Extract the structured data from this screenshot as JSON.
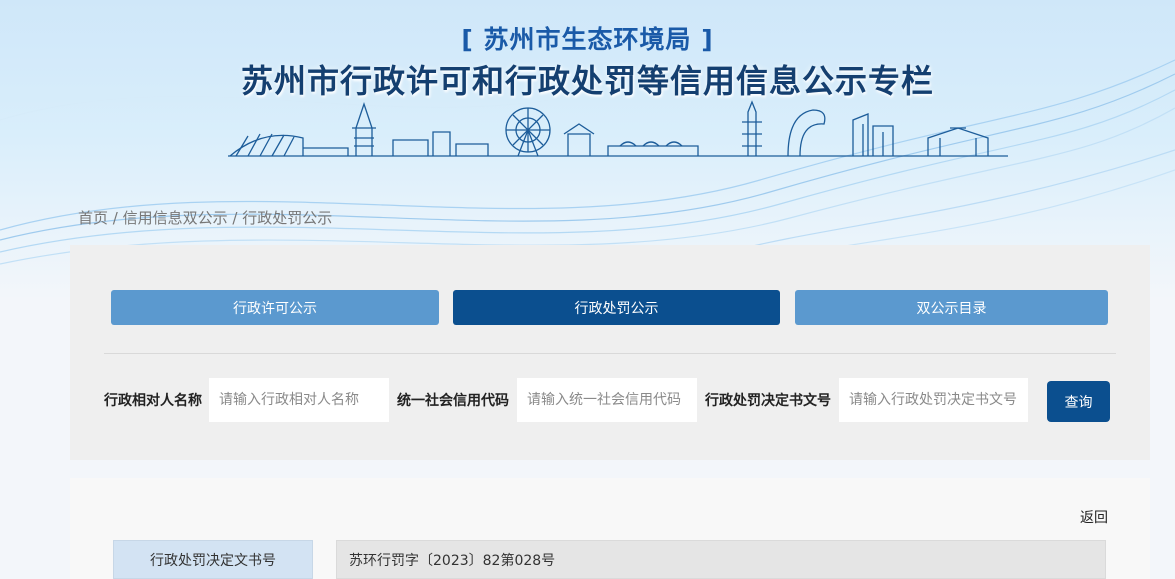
{
  "header": {
    "agency": "[ 苏州市生态环境局 ]",
    "title": "苏州市行政许可和行政处罚等信用信息公示专栏"
  },
  "breadcrumb": {
    "home": "首页",
    "sep": " / ",
    "level2": "信用信息双公示",
    "level3": "行政处罚公示"
  },
  "tabs": [
    {
      "label": "行政许可公示",
      "active": false
    },
    {
      "label": "行政处罚公示",
      "active": true
    },
    {
      "label": "双公示目录",
      "active": false
    }
  ],
  "filters": {
    "party_name": {
      "label": "行政相对人名称",
      "placeholder": "请输入行政相对人名称"
    },
    "credit_code": {
      "label": "统一社会信用代码",
      "placeholder": "请输入统一社会信用代码"
    },
    "decision_no": {
      "label": "行政处罚决定书文号",
      "placeholder": "请输入行政处罚决定书文号"
    },
    "search_label": "查询"
  },
  "detail": {
    "back_label": "返回",
    "rows": [
      {
        "label": "行政处罚决定文书号",
        "value": "苏环行罚字〔2023〕82第028号"
      }
    ]
  },
  "colors": {
    "primary": "#0b4f8f",
    "tab_inactive": "#5b99cf",
    "title": "#143f70",
    "agency": "#1a5aa8"
  }
}
